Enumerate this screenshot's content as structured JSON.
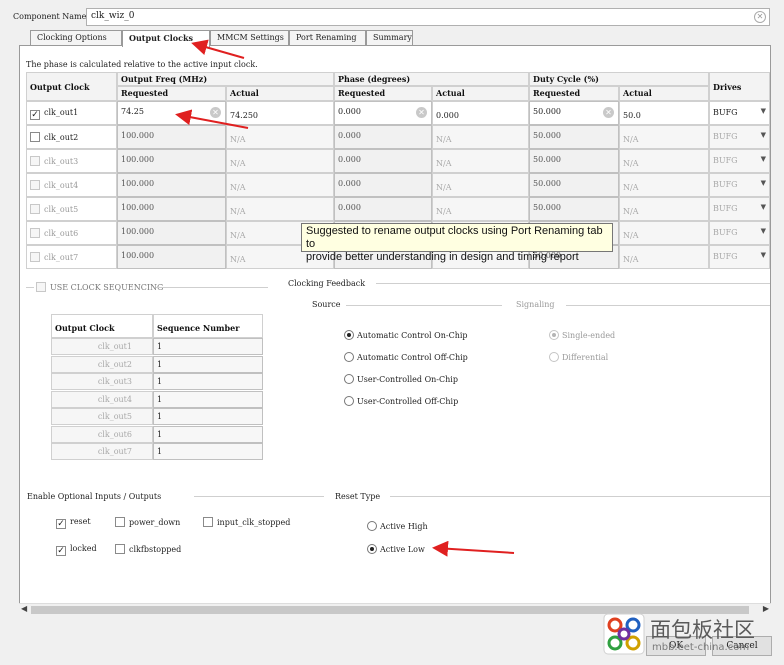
{
  "component": {
    "label": "Component Name",
    "value": "clk_wiz_0"
  },
  "tabs": [
    {
      "label": "Clocking Options"
    },
    {
      "label": "Output Clocks"
    },
    {
      "label": "MMCM Settings"
    },
    {
      "label": "Port Renaming"
    },
    {
      "label": "Summary"
    }
  ],
  "active_tab": "Output Clocks",
  "phase_note": "The phase is calculated relative to the active input clock.",
  "table": {
    "headers": {
      "output_clock": "Output Clock",
      "output_freq": "Output Freq (MHz)",
      "phase": "Phase (degrees)",
      "duty": "Duty Cycle (%)",
      "drives": "Drives",
      "requested": "Requested",
      "actual": "Actual"
    },
    "rows": [
      {
        "name": "clk_out1",
        "checked": true,
        "enabled": true,
        "freq_req": "74.25",
        "freq_act": "74.250",
        "phase_req": "0.000",
        "phase_act": "0.000",
        "duty_req": "50.000",
        "duty_act": "50.0",
        "drives": "BUFG"
      },
      {
        "name": "clk_out2",
        "checked": false,
        "enabled": true,
        "freq_req": "100.000",
        "freq_act": "N/A",
        "phase_req": "0.000",
        "phase_act": "N/A",
        "duty_req": "50.000",
        "duty_act": "N/A",
        "drives": "BUFG"
      },
      {
        "name": "clk_out3",
        "checked": false,
        "enabled": false,
        "freq_req": "100.000",
        "freq_act": "N/A",
        "phase_req": "0.000",
        "phase_act": "N/A",
        "duty_req": "50.000",
        "duty_act": "N/A",
        "drives": "BUFG"
      },
      {
        "name": "clk_out4",
        "checked": false,
        "enabled": false,
        "freq_req": "100.000",
        "freq_act": "N/A",
        "phase_req": "0.000",
        "phase_act": "N/A",
        "duty_req": "50.000",
        "duty_act": "N/A",
        "drives": "BUFG"
      },
      {
        "name": "clk_out5",
        "checked": false,
        "enabled": false,
        "freq_req": "100.000",
        "freq_act": "N/A",
        "phase_req": "0.000",
        "phase_act": "N/A",
        "duty_req": "50.000",
        "duty_act": "N/A",
        "drives": "BUFG"
      },
      {
        "name": "clk_out6",
        "checked": false,
        "enabled": false,
        "freq_req": "100.000",
        "freq_act": "N/A",
        "phase_req": "",
        "phase_act": "",
        "duty_req": "",
        "duty_act": "N/A",
        "drives": "BUFG"
      },
      {
        "name": "clk_out7",
        "checked": false,
        "enabled": false,
        "freq_req": "100.000",
        "freq_act": "N/A",
        "phase_req": "",
        "phase_act": "",
        "duty_req": "50.000",
        "duty_act": "N/A",
        "drives": "BUFG"
      }
    ]
  },
  "tooltip": {
    "line1": "Suggested to rename output clocks using Port Renaming tab to",
    "line2": "provide better understanding in design and timing report"
  },
  "sequencing": {
    "label": "USE CLOCK SEQUENCING",
    "checked": false,
    "headers": {
      "clock": "Output Clock",
      "seq": "Sequence Number"
    },
    "rows": [
      {
        "name": "clk_out1",
        "seq": "1"
      },
      {
        "name": "clk_out2",
        "seq": "1"
      },
      {
        "name": "clk_out3",
        "seq": "1"
      },
      {
        "name": "clk_out4",
        "seq": "1"
      },
      {
        "name": "clk_out5",
        "seq": "1"
      },
      {
        "name": "clk_out6",
        "seq": "1"
      },
      {
        "name": "clk_out7",
        "seq": "1"
      }
    ]
  },
  "feedback": {
    "title": "Clocking Feedback",
    "source_label": "Source",
    "signaling_label": "Signaling",
    "source_options": [
      {
        "label": "Automatic Control On-Chip",
        "selected": true
      },
      {
        "label": "Automatic Control Off-Chip",
        "selected": false
      },
      {
        "label": "User-Controlled On-Chip",
        "selected": false
      },
      {
        "label": "User-Controlled Off-Chip",
        "selected": false
      }
    ],
    "signaling_options": [
      {
        "label": "Single-ended",
        "selected": true
      },
      {
        "label": "Differential",
        "selected": false
      }
    ]
  },
  "optional_io": {
    "title": "Enable Optional Inputs / Outputs",
    "options": [
      {
        "label": "reset",
        "checked": true
      },
      {
        "label": "power_down",
        "checked": false
      },
      {
        "label": "input_clk_stopped",
        "checked": false
      },
      {
        "label": "locked",
        "checked": true
      },
      {
        "label": "clkfbstopped",
        "checked": false
      }
    ]
  },
  "reset_type": {
    "title": "Reset Type",
    "options": [
      {
        "label": "Active High",
        "selected": false
      },
      {
        "label": "Active Low",
        "selected": true
      }
    ]
  },
  "buttons": {
    "ok": "OK",
    "cancel": "Cancel"
  },
  "watermark": {
    "text": "面包板社区",
    "url": "mbb.eet-china.com"
  },
  "colors": {
    "annotation_red": "#e02020",
    "tooltip_bg": "#ffffe1"
  }
}
